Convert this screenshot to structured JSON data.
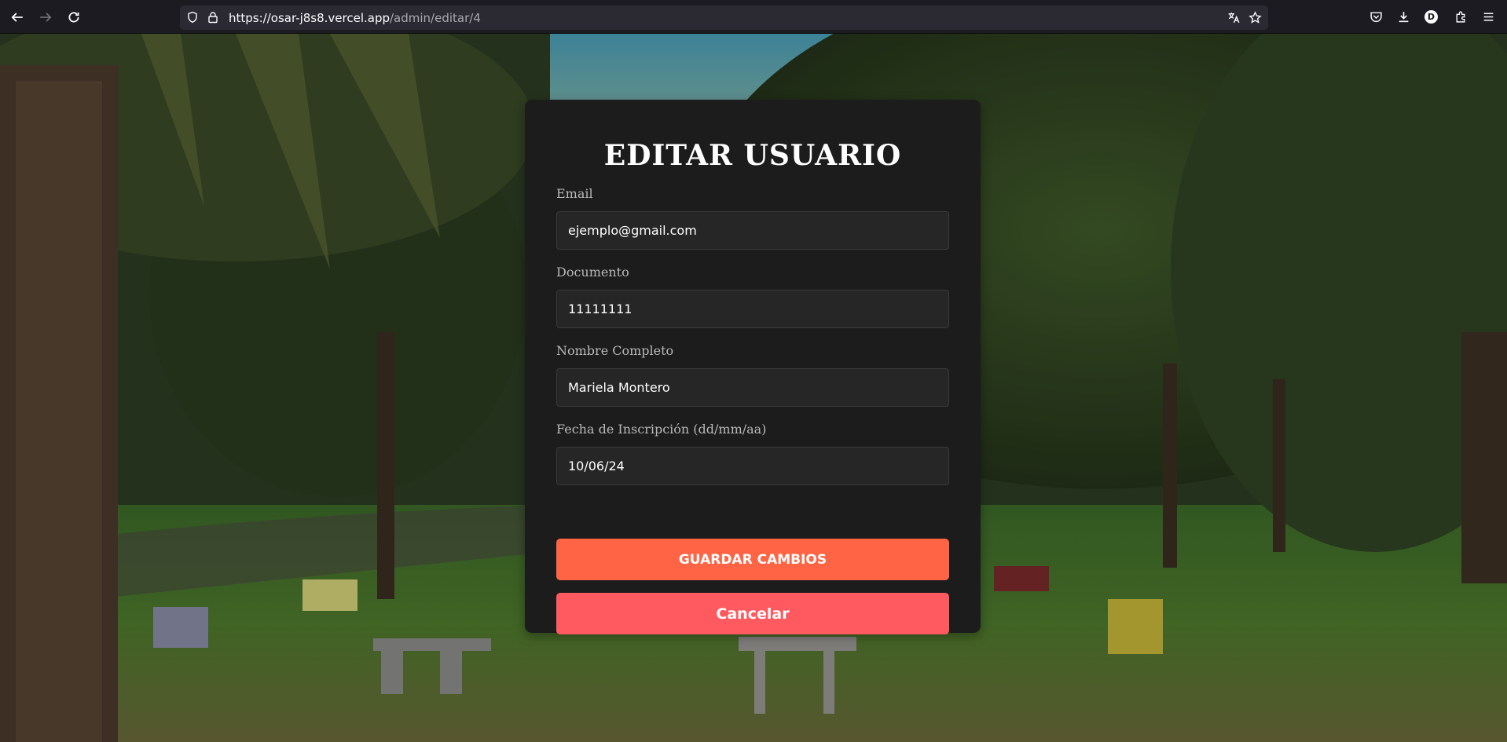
{
  "browser": {
    "url_host": "https://osar-j8s8.vercel.app",
    "url_path": "/admin/editar/4",
    "profile_initial": "D",
    "icons": [
      "back-arrow-icon",
      "forward-arrow-icon",
      "reload-icon",
      "shield-icon",
      "lock-icon",
      "translate-icon",
      "bookmark-star-icon",
      "pocket-icon",
      "download-icon",
      "extensions-icon",
      "menu-icon"
    ]
  },
  "form": {
    "title": "EDITAR USUARIO",
    "fields": [
      {
        "label": "Email",
        "value": "ejemplo@gmail.com"
      },
      {
        "label": "Documento",
        "value": "11111111"
      },
      {
        "label": "Nombre Completo",
        "value": "Mariela Montero"
      },
      {
        "label": "Fecha de Inscripción (dd/mm/aa)",
        "value": "10/06/24"
      }
    ],
    "save_label": "GUARDAR CAMBIOS",
    "cancel_label": "Cancelar"
  },
  "colors": {
    "save_button": "#ff6444",
    "cancel_button": "#ff5a5f",
    "card_background": "#1c1c1c"
  }
}
